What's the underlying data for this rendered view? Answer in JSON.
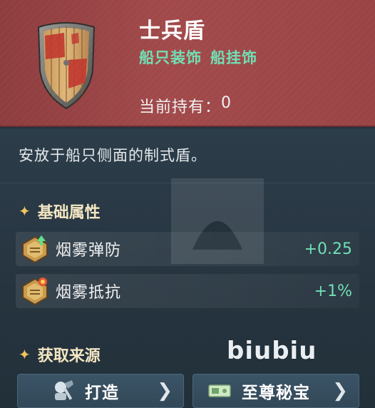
{
  "item": {
    "name": "士兵盾",
    "tags": [
      "船只装饰",
      "船挂饰"
    ],
    "owned_label": "当前持有：",
    "owned_count": "0",
    "icon": "wooden-shield-icon"
  },
  "description": "安放于船只侧面的制式盾。",
  "base_attributes": {
    "title": "基础属性",
    "items": [
      {
        "label": "烟雾弹防",
        "value": "+0.25",
        "icon": "smoke-defense-icon"
      },
      {
        "label": "烟雾抵抗",
        "value": "+1%",
        "icon": "smoke-resist-icon"
      }
    ]
  },
  "acquire": {
    "title": "获取来源",
    "buttons": [
      {
        "label": "打造",
        "icon": "crafting-icon"
      },
      {
        "label": "至尊秘宝",
        "icon": "ticket-icon"
      }
    ]
  },
  "watermark": "biubiu",
  "colors": {
    "header_bg": "#a24a4b",
    "accent_green": "#6fe0b4",
    "panel_bg": "#26343f",
    "section_gold": "#f3e6c2"
  }
}
